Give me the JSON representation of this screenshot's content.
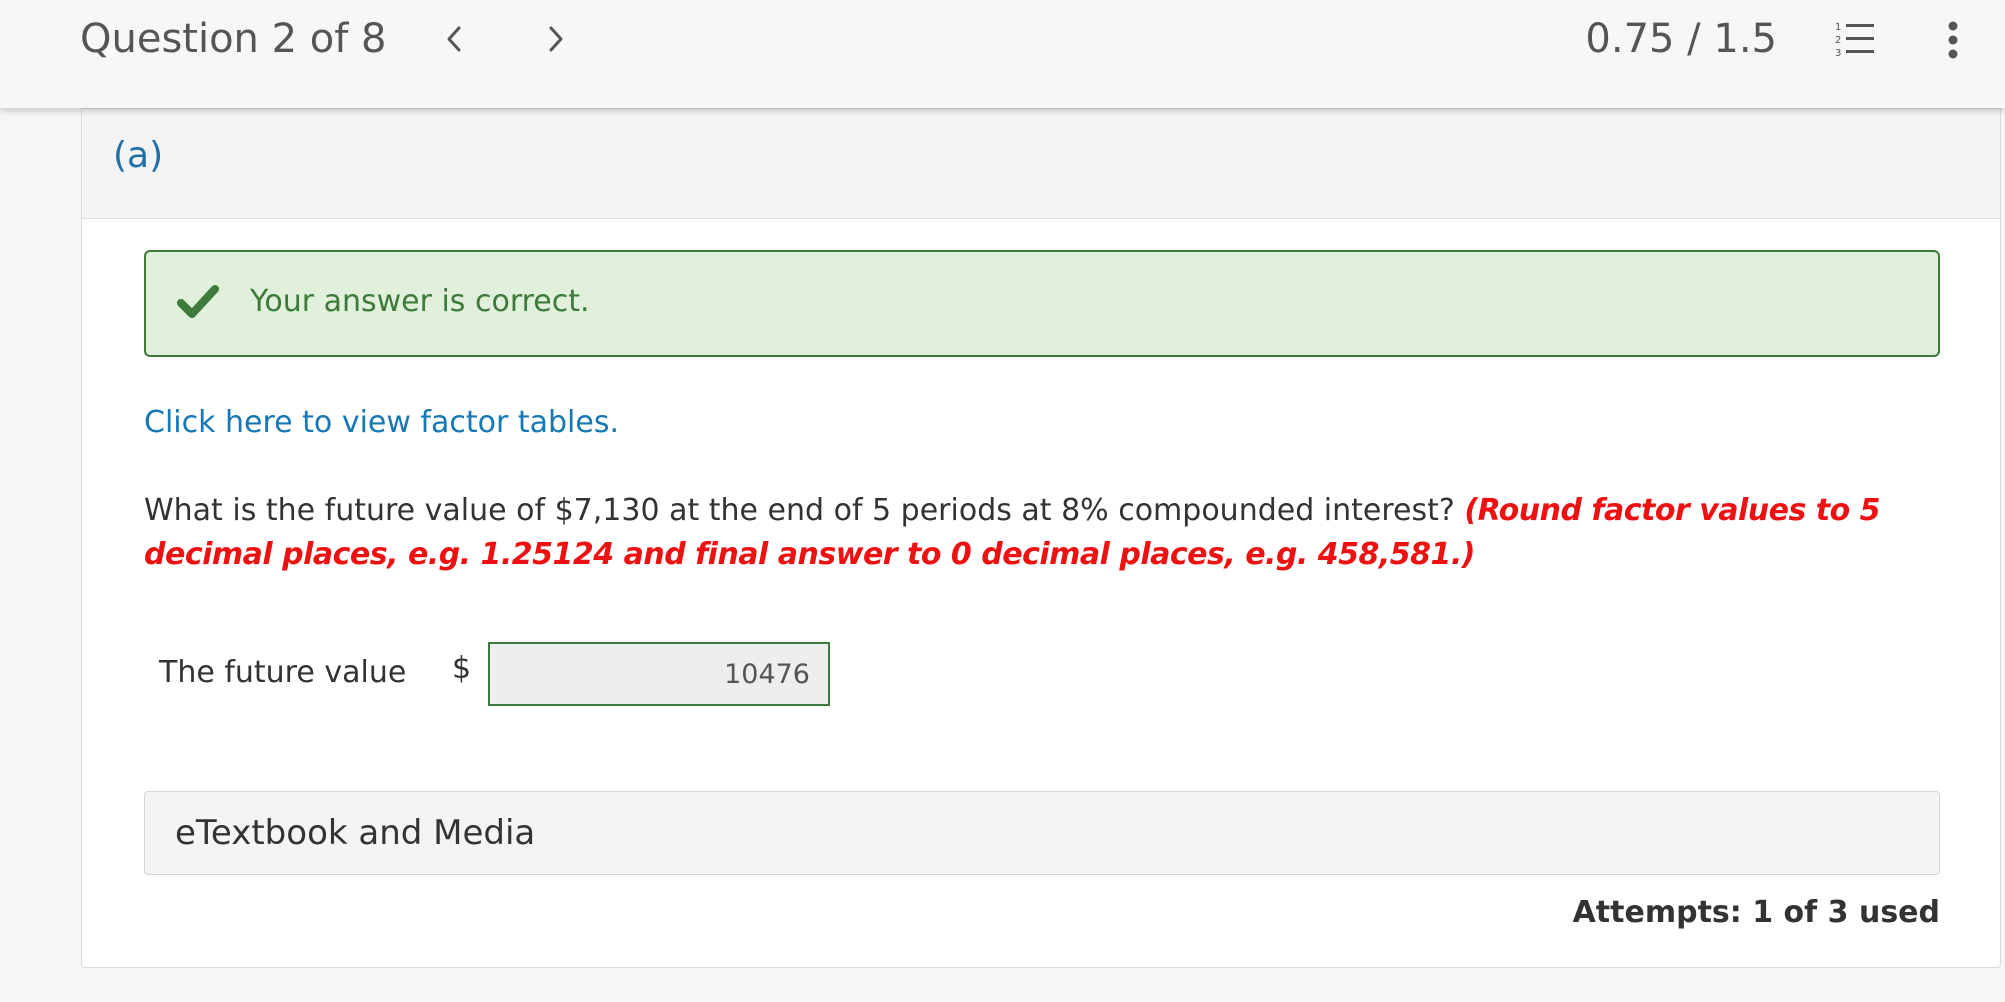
{
  "header": {
    "question_counter": "Question 2 of 8",
    "prev_icon": "chevron-left-icon",
    "next_icon": "chevron-right-icon",
    "score": "0.75 / 1.5",
    "list_icon": "numbered-list-icon",
    "more_icon": "more-vertical-icon"
  },
  "part": {
    "label": "(a)"
  },
  "feedback": {
    "icon": "checkmark-icon",
    "message": "Your answer is correct.",
    "color": "#3d7a3b",
    "background": "#e1f0da"
  },
  "factor_link": "Click here to view factor tables.",
  "question": {
    "text": "What is the future value of $7,130 at the end of 5 periods at 8% compounded interest?",
    "instruction": "(Round factor values to 5 decimal places, e.g. 1.25124 and final answer to 0 decimal places, e.g. 458,581.)",
    "instruction_color": "#ee1111"
  },
  "answer": {
    "label": "The future value",
    "currency": "$",
    "value": "10476"
  },
  "resources": {
    "label": "eTextbook and Media"
  },
  "attempts": "Attempts: 1 of 3 used",
  "colors": {
    "link": "#1778b5",
    "part_label": "#1f6fa8"
  }
}
